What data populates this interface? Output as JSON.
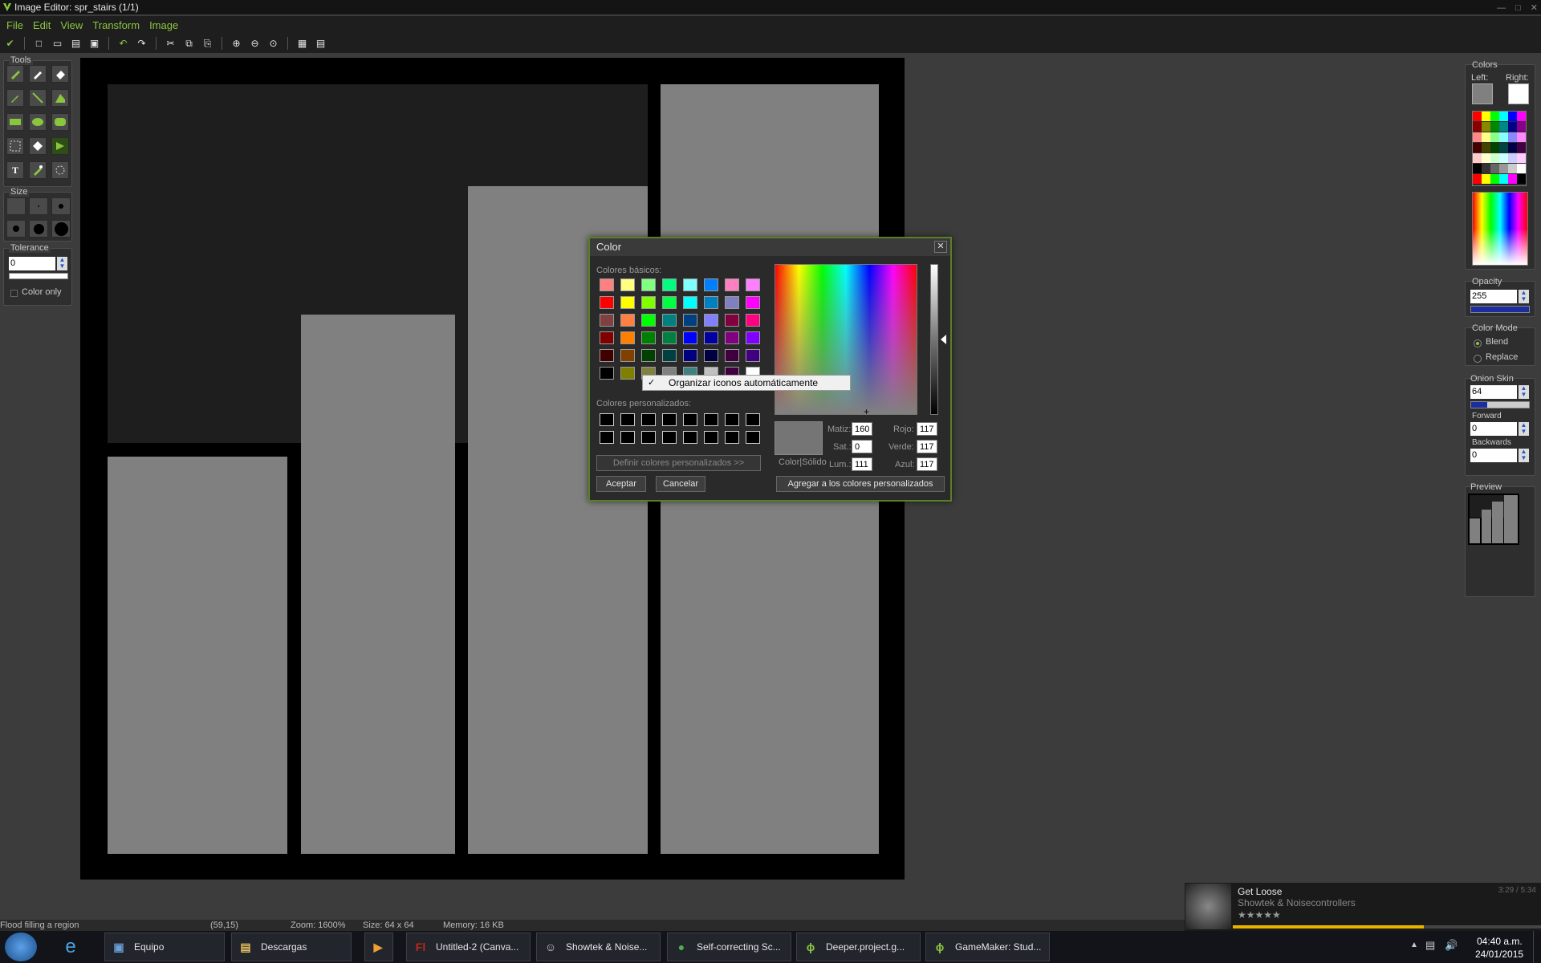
{
  "window": {
    "title": "Image Editor: spr_stairs (1/1)"
  },
  "menu": [
    "File",
    "Edit",
    "View",
    "Transform",
    "Image"
  ],
  "toolbar_icons": [
    "confirm-icon",
    "new-icon",
    "open-icon",
    "open-folder-icon",
    "save-icon",
    "undo-icon",
    "redo-icon",
    "cut-icon",
    "copy-icon",
    "paste-icon",
    "zoom-in-icon",
    "zoom-out-icon",
    "zoom-reset-icon",
    "grid-icon",
    "grid-settings-icon"
  ],
  "left_panel": {
    "tools_title": "Tools",
    "size_title": "Size",
    "tolerance_title": "Tolerance",
    "tolerance_value": "0",
    "color_only_label": "Color only"
  },
  "color_dialog": {
    "title": "Color",
    "close": "✕",
    "basic_colors_label": "Colores básicos:",
    "custom_colors_label": "Colores personalizados:",
    "define_custom_button": "Definir colores personalizados >>",
    "ok_button": "Aceptar",
    "cancel_button": "Cancelar",
    "add_custom_button": "Agregar a los colores personalizados",
    "solid_color_label": "Color|Sólido",
    "hue_label": "Matiz:",
    "hue_value": "160",
    "sat_label": "Sat.:",
    "sat_value": "0",
    "lum_label": "Lum.:",
    "lum_value": "111",
    "red_label": "Rojo:",
    "red_value": "117",
    "green_label": "Verde:",
    "green_value": "117",
    "blue_label": "Azul:",
    "blue_value": "117",
    "context_menu_item": "Organizar iconos automáticamente",
    "current_color": "#757575",
    "basic_colors": [
      [
        "#ff8080",
        "#ffff80",
        "#80ff80",
        "#00ff80",
        "#80ffff",
        "#0080ff",
        "#ff80c0",
        "#ff80ff"
      ],
      [
        "#ff0000",
        "#ffff00",
        "#80ff00",
        "#00ff40",
        "#00ffff",
        "#0080c0",
        "#8080c0",
        "#ff00ff"
      ],
      [
        "#804040",
        "#ff8040",
        "#00ff00",
        "#008080",
        "#004080",
        "#8080ff",
        "#800040",
        "#ff0080"
      ],
      [
        "#800000",
        "#ff8000",
        "#008000",
        "#008040",
        "#0000ff",
        "#0000a0",
        "#800080",
        "#8000ff"
      ],
      [
        "#400000",
        "#804000",
        "#004000",
        "#004040",
        "#000080",
        "#000040",
        "#400040",
        "#400080"
      ],
      [
        "#000000",
        "#808000",
        "#808040",
        "#808080",
        "#408080",
        "#c0c0c0",
        "#400040",
        "#ffffff"
      ]
    ]
  },
  "right_panel": {
    "colors_title": "Colors",
    "left_label": "Left:",
    "right_label": "Right:",
    "left_color": "#808080",
    "right_color": "#ffffff",
    "opacity_title": "Opacity",
    "opacity_value": "255",
    "color_mode_title": "Color Mode",
    "blend_label": "Blend",
    "replace_label": "Replace",
    "onion_title": "Onion Skin",
    "onion_value": "64",
    "forward_label": "Forward",
    "forward_value": "0",
    "backwards_label": "Backwards",
    "backwards_value": "0",
    "preview_title": "Preview"
  },
  "statusbar": {
    "message": "Flood filling a region",
    "coords": "(59,15)",
    "zoom": "Zoom: 1600%",
    "size": "Size: 64 x 64",
    "memory": "Memory: 16 KB"
  },
  "media": {
    "song": "Get Loose",
    "artist": "Showtek & Noisecontrollers",
    "time": "3:29 / 5:34",
    "progress": 0.62,
    "rating": "★★★★★"
  },
  "taskbar": {
    "items": [
      {
        "label": "Equipo",
        "icon_text": "▣",
        "color": "#6aa0d8"
      },
      {
        "label": "Descargas",
        "icon_text": "▤",
        "color": "#e8c060"
      },
      {
        "label": "",
        "icon_text": "▶",
        "color": "#f0a030"
      },
      {
        "label": "Untitled-2 (Canva...",
        "icon_text": "Fl",
        "color": "#c0281c"
      },
      {
        "label": "Showtek & Noise...",
        "icon_text": "☺",
        "color": "#d0d0d0"
      },
      {
        "label": "Self-correcting Sc...",
        "icon_text": "●",
        "color": "#4caf50"
      },
      {
        "label": "Deeper.project.g...",
        "icon_text": "ɸ",
        "color": "#8ac53e"
      },
      {
        "label": "GameMaker: Stud...",
        "icon_text": "ɸ",
        "color": "#8ac53e"
      }
    ],
    "clock_time": "04:40 a.m.",
    "clock_date": "24/01/2015"
  }
}
